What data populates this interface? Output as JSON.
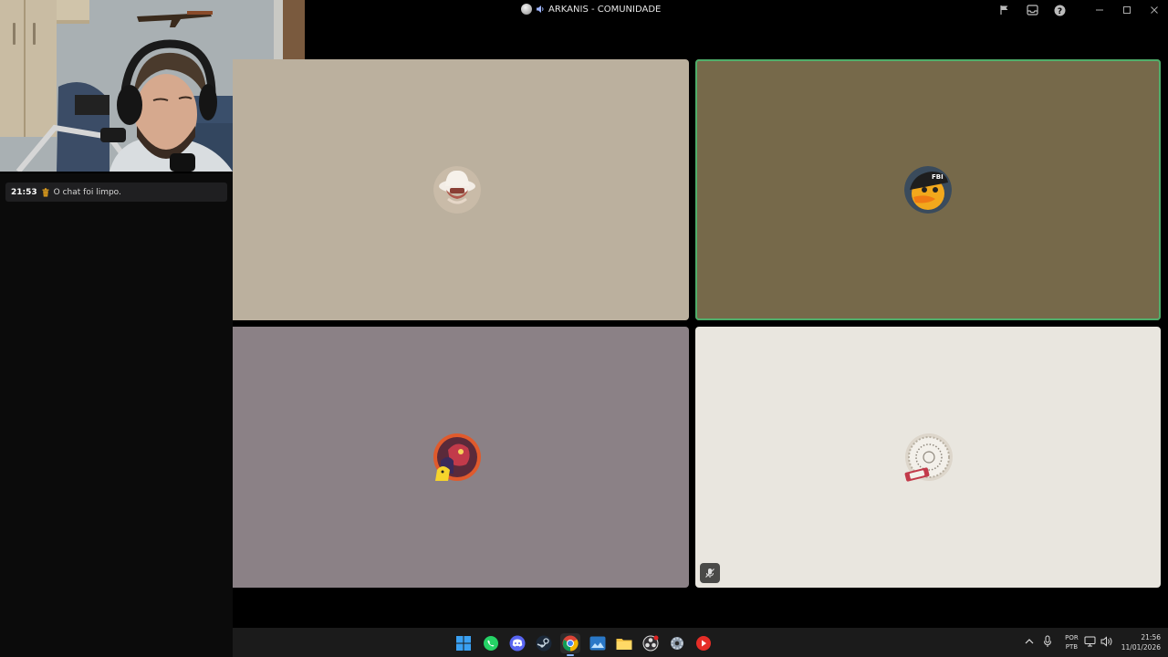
{
  "window": {
    "title": "ARKANIS - COMUNIDADE",
    "icons": [
      "globe-icon",
      "speaker-icon"
    ],
    "controls": [
      "flag-icon",
      "inbox-icon",
      "help-icon",
      "minimize-icon",
      "maximize-icon",
      "close-icon"
    ]
  },
  "chat": {
    "messages": [
      {
        "time": "21:53",
        "icon": "trash-icon",
        "text": "O chat foi limpo."
      }
    ]
  },
  "tiles": [
    {
      "bg": "#bbb09e",
      "avatar": "cowboy-hat-avatar",
      "speaking": false,
      "muted": false
    },
    {
      "bg": "#76694a",
      "avatar": "duck-avatar",
      "speaking": true,
      "muted": false
    },
    {
      "bg": "#8b8186",
      "avatar": "cartoon-character-avatar",
      "speaking": false,
      "muted": false
    },
    {
      "bg": "#e9e6df",
      "avatar": "stamp-avatar",
      "speaking": false,
      "muted": true
    }
  ],
  "taskbar": {
    "apps": [
      "windows-start-icon",
      "whatsapp-icon",
      "discord-icon",
      "steam-icon",
      "chrome-icon",
      "photos-icon",
      "file-explorer-icon",
      "obs-icon",
      "settings-icon",
      "youtube-icon"
    ],
    "active_app": "chrome-icon",
    "tray": {
      "lang_top": "POR",
      "lang_bottom": "PTB",
      "time": "21:56",
      "date": "11/01/2026"
    }
  },
  "colors": {
    "speaking_outline": "#4fae6a",
    "chat_bg": "#0b0b0b",
    "taskbar_bg": "#1b1b1b"
  }
}
